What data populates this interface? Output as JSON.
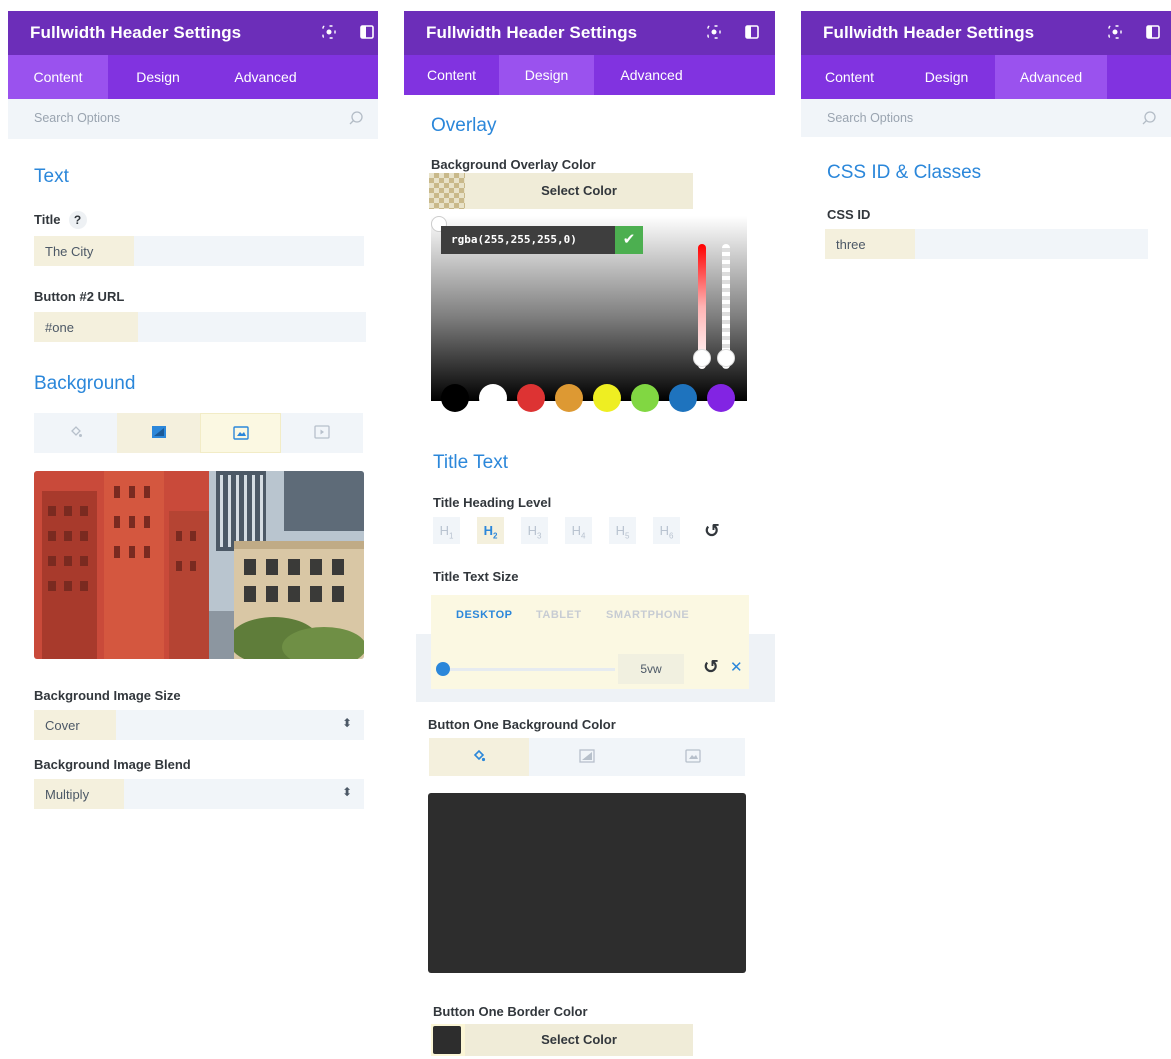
{
  "panels": {
    "content": {
      "header": {
        "title": "Fullwidth Header Settings"
      },
      "tabs": [
        {
          "label": "Content",
          "active": true
        },
        {
          "label": "Design"
        },
        {
          "label": "Advanced"
        }
      ],
      "search": {
        "placeholder": "Search Options"
      },
      "text_section": {
        "heading": "Text"
      },
      "title_field": {
        "label": "Title",
        "help": "?",
        "value": "The City"
      },
      "button2_url": {
        "label": "Button #2 URL",
        "value": "#one"
      },
      "background_section": {
        "heading": "Background"
      },
      "bg_image_size": {
        "label": "Background Image Size",
        "value": "Cover",
        "caret": "⬍"
      },
      "bg_image_blend": {
        "label": "Background Image Blend",
        "value": "Multiply",
        "caret": "⬍"
      }
    },
    "design": {
      "header": {
        "title": "Fullwidth Header Settings"
      },
      "tabs": [
        {
          "label": "Content"
        },
        {
          "label": "Design",
          "active": true
        },
        {
          "label": "Advanced"
        }
      ],
      "overlay_section": {
        "heading": "Overlay"
      },
      "bg_overlay_color": {
        "label": "Background Overlay Color",
        "button": "Select Color"
      },
      "color_picker": {
        "value": "rgba(255,255,255,0)",
        "palette": [
          "#000000",
          "#ffffff",
          "#dd3333",
          "#dd9933",
          "#eeee22",
          "#81d742",
          "#1e73be",
          "#8224e3"
        ]
      },
      "title_text_section": {
        "heading": "Title Text"
      },
      "heading_level": {
        "label": "Title Heading Level",
        "levels": [
          {
            "h": "H",
            "n": "1"
          },
          {
            "h": "H",
            "n": "2",
            "selected": true
          },
          {
            "h": "H",
            "n": "3"
          },
          {
            "h": "H",
            "n": "4"
          },
          {
            "h": "H",
            "n": "5"
          },
          {
            "h": "H",
            "n": "6"
          }
        ]
      },
      "title_text_size": {
        "label": "Title Text Size",
        "devices": [
          {
            "label": "DESKTOP",
            "active": true
          },
          {
            "label": "TABLET"
          },
          {
            "label": "SMARTPHONE"
          }
        ],
        "value": "5vw",
        "reset": "↺",
        "clear": "✕"
      },
      "button_one_bg": {
        "label": "Button One Background Color",
        "preview_color": "#2d2d2d"
      },
      "button_one_border": {
        "label": "Button One Border Color",
        "button": "Select Color",
        "swatch_color": "#2d2d2d"
      }
    },
    "advanced": {
      "header": {
        "title": "Fullwidth Header Settings"
      },
      "tabs": [
        {
          "label": "Content"
        },
        {
          "label": "Design"
        },
        {
          "label": "Advanced",
          "active": true
        }
      ],
      "search": {
        "placeholder": "Search Options"
      },
      "css_section": {
        "heading": "CSS ID & Classes"
      },
      "css_id": {
        "label": "CSS ID",
        "value": "three"
      }
    }
  },
  "colors": {
    "header": "#6c2eb9",
    "tabbar": "#8133e0",
    "tab_active": "#9a52ee",
    "accent_blue": "#2b87da",
    "highlight": "#f4f0dd"
  }
}
